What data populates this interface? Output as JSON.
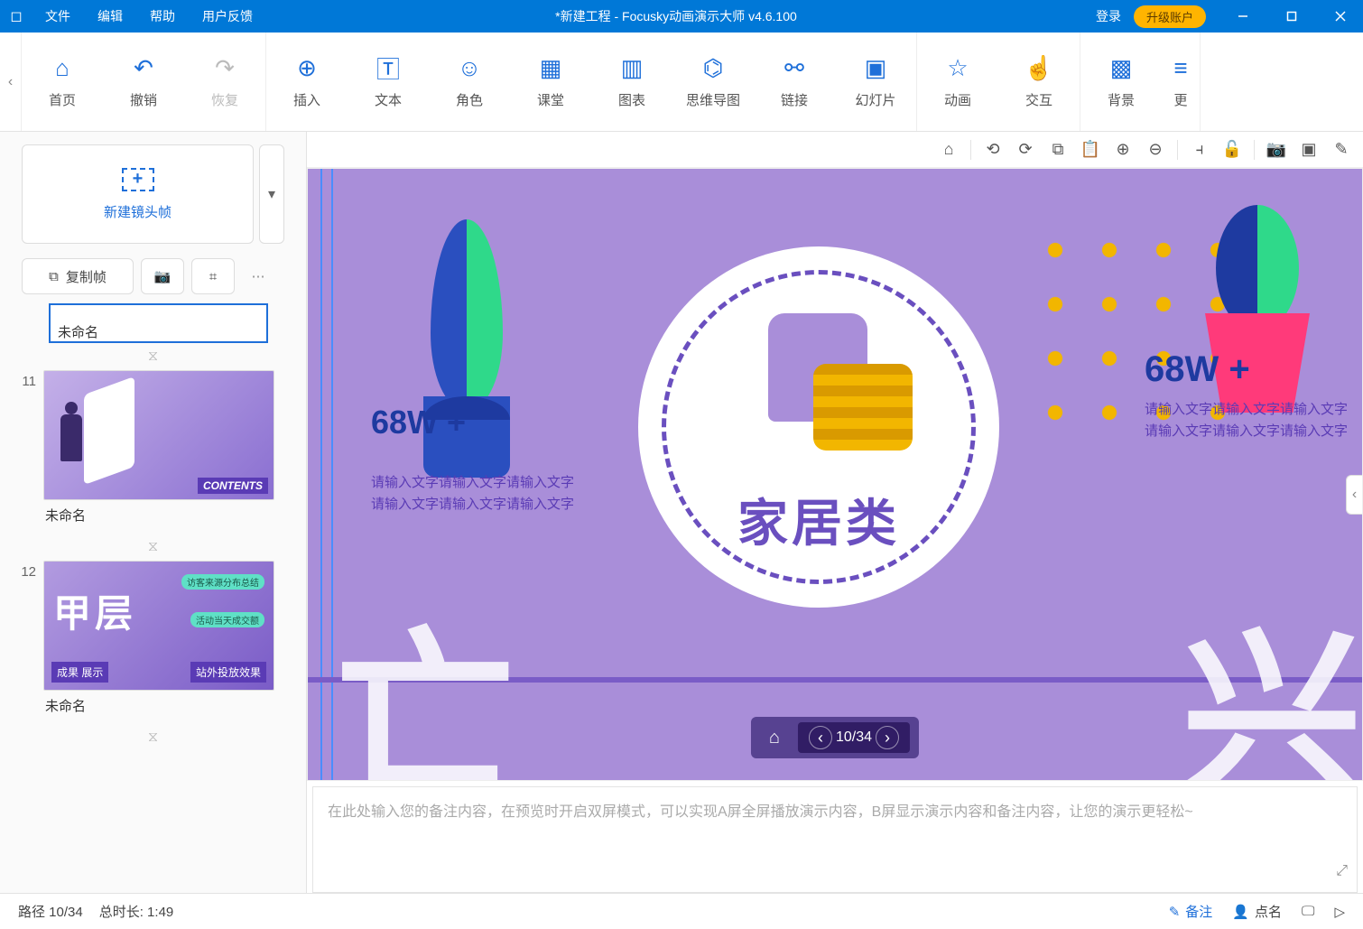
{
  "titlebar": {
    "menu": {
      "file": "文件",
      "edit": "编辑",
      "help": "帮助",
      "feedback": "用户反馈"
    },
    "title": "*新建工程 - Focusky动画演示大师  v4.6.100",
    "login": "登录",
    "upgrade": "升级账户"
  },
  "toolbar": {
    "home": "首页",
    "undo": "撤销",
    "redo": "恢复",
    "insert": "插入",
    "text": "文本",
    "role": "角色",
    "class": "课堂",
    "chart": "图表",
    "mindmap": "思维导图",
    "link": "链接",
    "slide": "幻灯片",
    "anim": "动画",
    "interact": "交互",
    "bg": "背景",
    "more": "更"
  },
  "sidebar": {
    "newframe": "新建镜头帧",
    "copy": "复制帧",
    "selected_name": "未命名",
    "items": [
      {
        "num": "11",
        "name": "未命名",
        "contents": "CONTENTS"
      },
      {
        "num": "12",
        "name": "未命名",
        "bigtxt": "甲层",
        "badge1": "成果\n展示",
        "badge2": "站外投放效果",
        "chip1": "访客来源分布总结",
        "chip2": "活动当天成交额"
      }
    ]
  },
  "canvas": {
    "center_title": "家居类",
    "stat_left_val": "68W +",
    "stat_left_sub1": "请输入文字请输入文字请输入文字",
    "stat_left_sub2": "请输入文字请输入文字请输入文字",
    "stat_right_val": "68W +",
    "stat_right_sub1": "请输入文字请输入文字请输入文字",
    "stat_right_sub2": "请输入文字请输入文字请输入文字",
    "nav_pos": "10/34"
  },
  "notes": {
    "placeholder": "在此处输入您的备注内容，在预览时开启双屏模式，可以实现A屏全屏播放演示内容，B屏显示演示内容和备注内容，让您的演示更轻松~"
  },
  "statusbar": {
    "path": "路径 10/34",
    "duration": "总时长: 1:49",
    "notes": "备注",
    "rollcall": "点名"
  }
}
